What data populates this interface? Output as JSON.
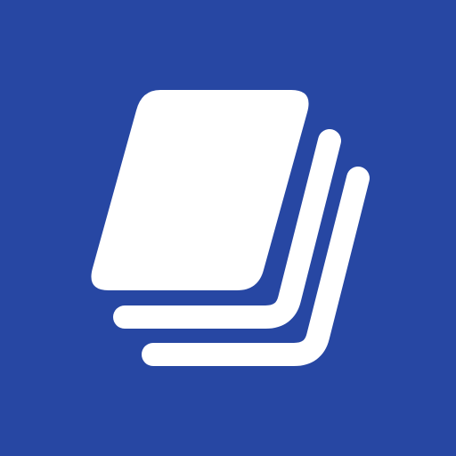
{
  "icon": {
    "name": "stacked-pages-icon",
    "background_color": "#2747a3",
    "foreground_color": "#ffffff"
  }
}
